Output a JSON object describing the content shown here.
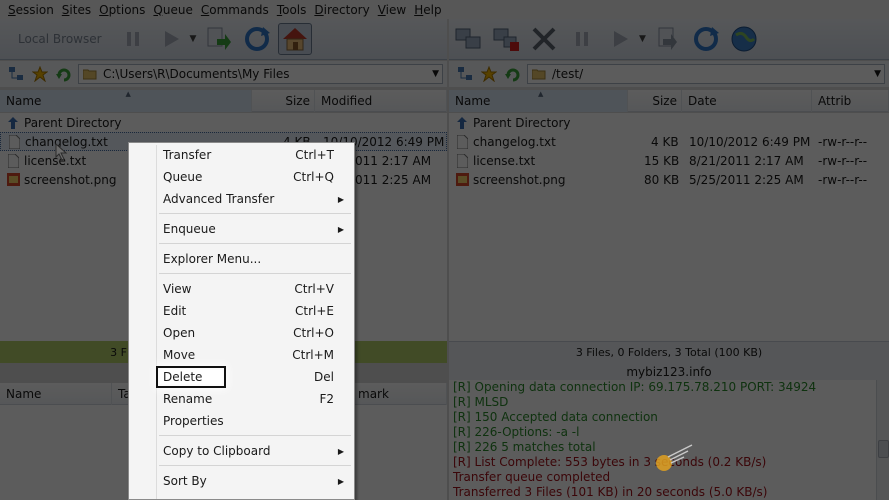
{
  "menubar": [
    "Session",
    "Sites",
    "Options",
    "Queue",
    "Commands",
    "Tools",
    "Directory",
    "View",
    "Help"
  ],
  "toolbar": {
    "local_browser_label": "Local Browser"
  },
  "local": {
    "path": "C:\\Users\\R\\Documents\\My Files",
    "columns": {
      "name": "Name",
      "size": "Size",
      "modified": "Modified"
    },
    "rows": [
      {
        "name": "Parent Directory",
        "size": "",
        "modified": ""
      },
      {
        "name": "changelog.txt",
        "size": "4 KB",
        "modified": "10/10/2012 6:49 PM"
      },
      {
        "name": "license.txt",
        "size": "",
        "modified": "011 2:17 AM"
      },
      {
        "name": "screenshot.png",
        "size": "",
        "modified": "011 2:25 AM"
      }
    ],
    "status": "3 F"
  },
  "remote": {
    "path": "/test/",
    "columns": {
      "name": "Name",
      "size": "Size",
      "date": "Date",
      "attrib": "Attrib"
    },
    "rows": [
      {
        "name": "Parent Directory",
        "size": "",
        "date": "",
        "attrib": ""
      },
      {
        "name": "changelog.txt",
        "size": "4 KB",
        "date": "10/10/2012 6:49 PM",
        "attrib": "-rw-r--r--"
      },
      {
        "name": "license.txt",
        "size": "15 KB",
        "date": "8/21/2011 2:17 AM",
        "attrib": "-rw-r--r--"
      },
      {
        "name": "screenshot.png",
        "size": "80 KB",
        "date": "5/25/2011 2:25 AM",
        "attrib": "-rw-r--r--"
      }
    ],
    "status": "3 Files, 0 Folders, 3 Total (100 KB)",
    "host": "mybiz123.info"
  },
  "queue": {
    "columns": {
      "name": "Name",
      "target": "Ta",
      "remark": "mark"
    }
  },
  "log": [
    {
      "text": "[R] Opening data connection IP: 69.175.78.210 PORT: 34924",
      "color": "green"
    },
    {
      "text": "[R] MLSD",
      "color": "green"
    },
    {
      "text": "[R] 150 Accepted data connection",
      "color": "green"
    },
    {
      "text": "[R] 226-Options: -a -l",
      "color": "green"
    },
    {
      "text": "[R] 226 5 matches total",
      "color": "green"
    },
    {
      "text": "[R] List Complete: 553 bytes in 3 seconds (0.2 KB/s)",
      "color": "red"
    },
    {
      "text": "Transfer queue completed",
      "color": "red"
    },
    {
      "text": "Transferred 3 Files (101 KB) in 20 seconds (5.0 KB/s)",
      "color": "red"
    }
  ],
  "context_menu": {
    "transfer": {
      "label": "Transfer",
      "shortcut": "Ctrl+T"
    },
    "queue": {
      "label": "Queue",
      "shortcut": "Ctrl+Q"
    },
    "advanced": {
      "label": "Advanced Transfer"
    },
    "enqueue": {
      "label": "Enqueue"
    },
    "explorer": {
      "label": "Explorer Menu..."
    },
    "view": {
      "label": "View",
      "shortcut": "Ctrl+V"
    },
    "edit": {
      "label": "Edit",
      "shortcut": "Ctrl+E"
    },
    "open": {
      "label": "Open",
      "shortcut": "Ctrl+O"
    },
    "move": {
      "label": "Move",
      "shortcut": "Ctrl+M"
    },
    "delete": {
      "label": "Delete",
      "shortcut": "Del"
    },
    "rename": {
      "label": "Rename",
      "shortcut": "F2"
    },
    "properties": {
      "label": "Properties"
    },
    "clipboard": {
      "label": "Copy to Clipboard"
    },
    "sortby": {
      "label": "Sort By"
    }
  },
  "colors": {
    "status_green": "#b5cf6a",
    "log_green": "#2b8a2b",
    "log_red": "#a3121b"
  }
}
